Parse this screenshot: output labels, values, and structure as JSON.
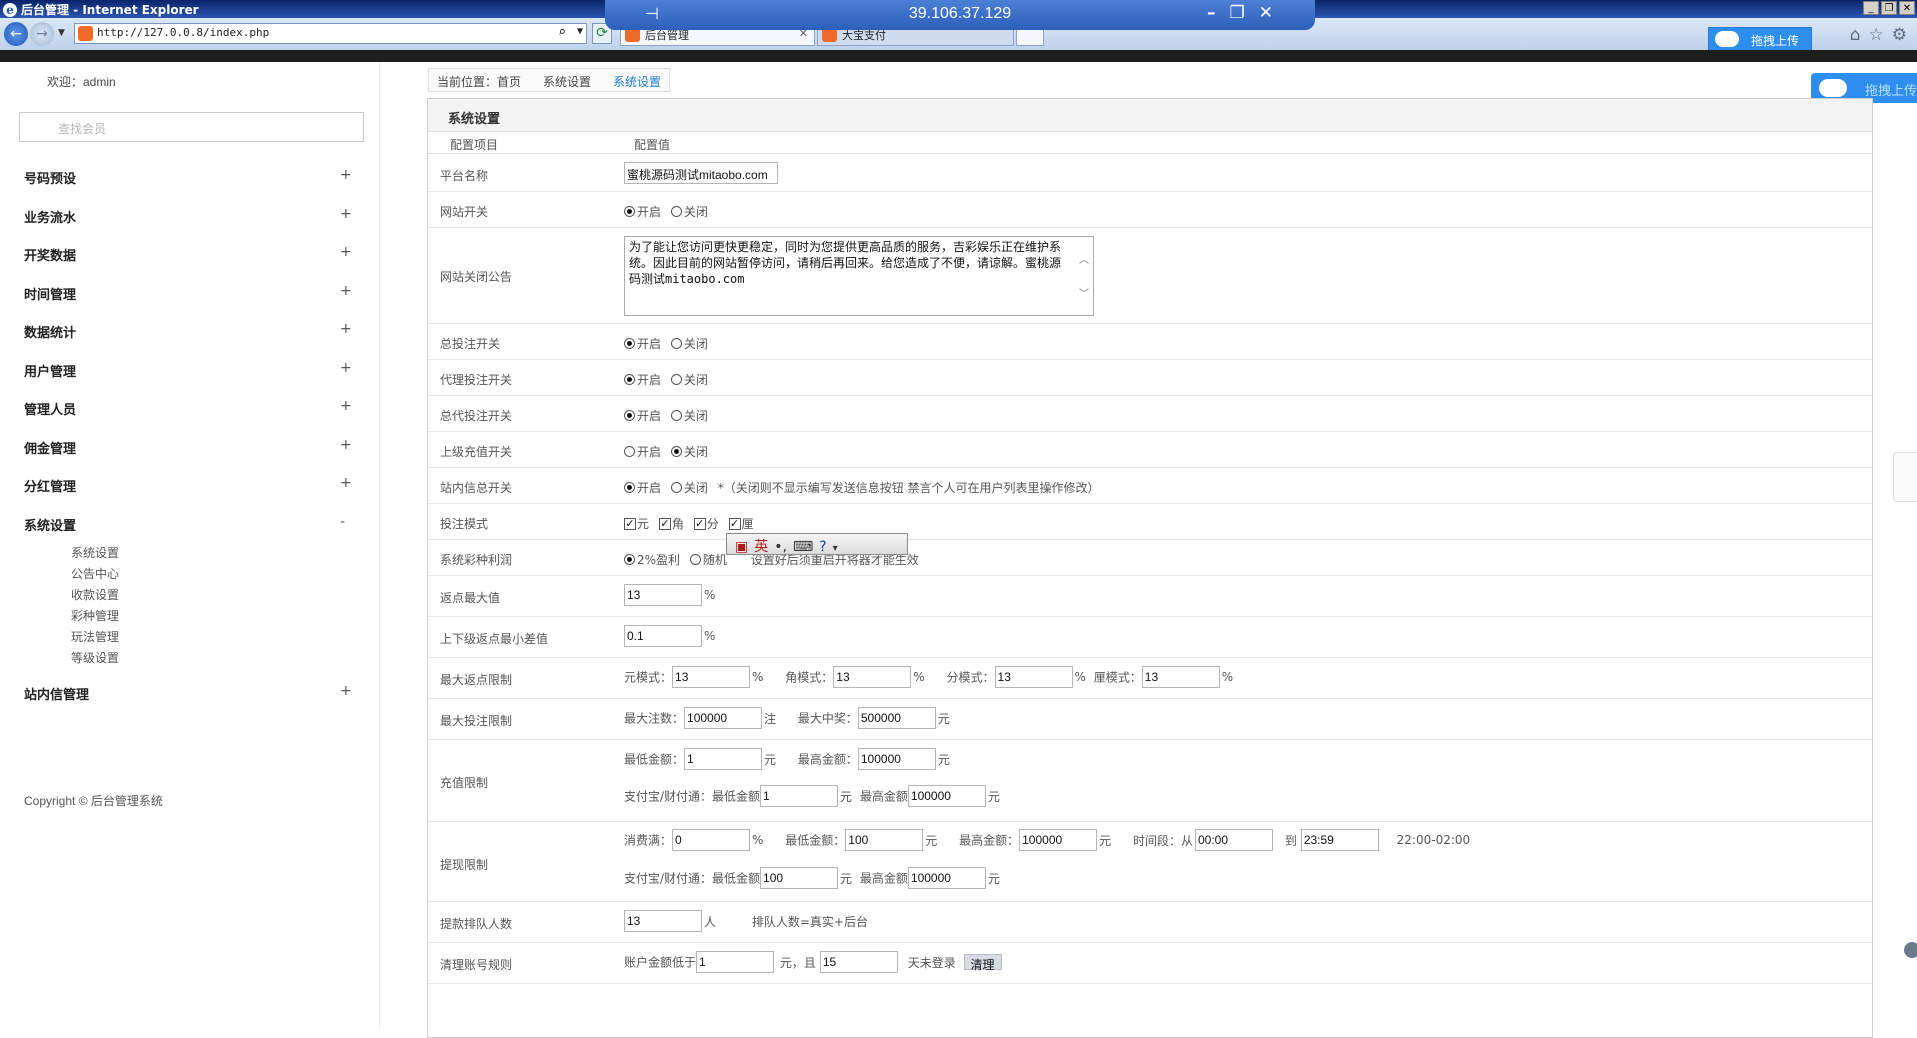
{
  "window": {
    "title": "后台管理 - Internet Explorer",
    "rdp_host": "39.106.37.129"
  },
  "browser": {
    "address": "http://127.0.0.8/index.php",
    "tabs": [
      {
        "label": "后台管理"
      },
      {
        "label": "大宝支付"
      }
    ],
    "baidu_upload": "拖拽上传"
  },
  "sidebar": {
    "welcome": "欢迎：admin",
    "search_placeholder": "查找会员",
    "menu": [
      {
        "label": "号码预设",
        "toggle": "+"
      },
      {
        "label": "业务流水",
        "toggle": "+"
      },
      {
        "label": "开奖数据",
        "toggle": "+"
      },
      {
        "label": "时间管理",
        "toggle": "+"
      },
      {
        "label": "数据统计",
        "toggle": "+"
      },
      {
        "label": "用户管理",
        "toggle": "+"
      },
      {
        "label": "管理人员",
        "toggle": "+"
      },
      {
        "label": "佣金管理",
        "toggle": "+"
      },
      {
        "label": "分红管理",
        "toggle": "+"
      },
      {
        "label": "系统设置",
        "toggle": "-"
      },
      {
        "label": "站内信管理",
        "toggle": "+"
      }
    ],
    "submenu": [
      "系统设置",
      "公告中心",
      "收款设置",
      "彩种管理",
      "玩法管理",
      "等级设置"
    ],
    "copyright": "Copyright © 后台管理系统"
  },
  "breadcrumb": {
    "home": "当前位置：首页",
    "parent": "系统设置",
    "current": "系统设置"
  },
  "right_upload": "拖拽上传",
  "panel": {
    "title": "系统设置",
    "col_item": "配置项目",
    "col_value": "配置值",
    "on": "开启",
    "off": "关闭",
    "rows": {
      "platform_name": {
        "label": "平台名称",
        "value": "蜜桃源码测试mitaobo.com"
      },
      "site_switch": {
        "label": "网站开关"
      },
      "close_notice": {
        "label": "网站关闭公告",
        "value": "为了能让您访问更快更稳定，同时为您提供更高品质的服务，吉彩娱乐正在维护系统。因此目前的网站暂停访问，请稍后再回来。给您造成了不便，请谅解。蜜桃源码测试mitaobo.com"
      },
      "bet_switch": {
        "label": "总投注开关"
      },
      "agent_bet_switch": {
        "label": "代理投注开关"
      },
      "general_agent_bet_switch": {
        "label": "总代投注开关"
      },
      "superior_recharge_switch": {
        "label": "上级充值开关"
      },
      "message_switch": {
        "label": "站内信总开关",
        "note": "*（关闭则不显示编写发送信息按钮 禁言个人可在用户列表里操作修改）"
      },
      "bet_mode": {
        "label": "投注模式",
        "modes": [
          "元",
          "角",
          "分",
          "厘"
        ]
      },
      "profit": {
        "label": "系统彩种利润",
        "opt1": "2%盈利",
        "opt2": "随机",
        "note": "设置好后须重启开将器才能生效"
      },
      "max_rebate": {
        "label": "返点最大值",
        "value": "13",
        "unit": "%"
      },
      "min_diff": {
        "label": "上下级返点最小差值",
        "value": "0.1",
        "unit": "%"
      },
      "max_rebate_limit": {
        "label": "最大返点限制",
        "items": [
          {
            "name": "元模式：",
            "value": "13"
          },
          {
            "name": "角模式：",
            "value": "13"
          },
          {
            "name": "分模式：",
            "value": "13"
          },
          {
            "name": "厘模式：",
            "value": "13"
          }
        ],
        "unit": "%"
      },
      "max_bet_limit": {
        "label": "最大投注限制",
        "count_name": "最大注数：",
        "count_value": "100000",
        "count_unit": "注",
        "win_name": "最大中奖：",
        "win_value": "500000",
        "win_unit": "元"
      },
      "recharge_limit": {
        "label": "充值限制",
        "min_name": "最低金额：",
        "min_value": "1",
        "max_name": "最高金额：",
        "max_value": "100000",
        "alipay_name": "支付宝/财付通：最低金额",
        "alipay_min": "1",
        "alipay_max_name": "最高金额",
        "alipay_max": "100000",
        "unit": "元"
      },
      "withdraw_limit": {
        "label": "提现限制",
        "consume_name": "消费满：",
        "consume_value": "0",
        "min_name": "最低金额：",
        "min_value": "100",
        "max_name": "最高金额：",
        "max_value": "100000",
        "time_name": "时间段：从",
        "time_from": "00:00",
        "to": "到",
        "time_to": "23:59",
        "time_note": "22:00-02:00",
        "alipay_name": "支付宝/财付通：最低金额",
        "alipay_min": "100",
        "alipay_max_name": "最高金额",
        "alipay_max": "100000",
        "unit": "元",
        "pct": "%"
      },
      "queue": {
        "label": "提款排队人数",
        "value": "13",
        "unit": "人",
        "note": "排队人数=真实+后台"
      },
      "cleanup": {
        "label": "清理账号规则",
        "balance_name": "账户金额低于",
        "balance_value": "1",
        "and": "元，且",
        "days_value": "15",
        "days_unit": "天未登录",
        "button": "清理"
      }
    }
  },
  "ime": {
    "label": "英"
  }
}
